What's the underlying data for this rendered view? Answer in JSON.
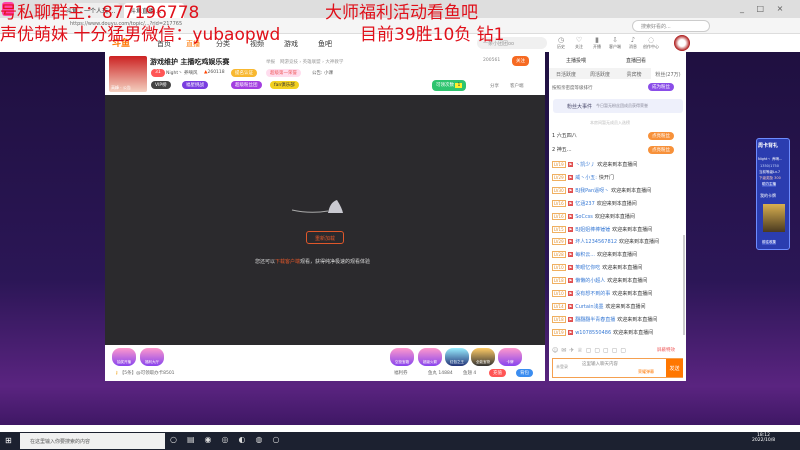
{
  "browser": {
    "tabs": [
      "斗鱼 - 一个人玩 ...",
      "斗鱼直播 ..."
    ],
    "url": "https://www.douyu.com/topic/...?rid=217765",
    "search_placeholder": "搜索好看的...",
    "window_controls": [
      "_",
      "□",
      "×"
    ]
  },
  "overlay": {
    "line1_left": "号私聊群主：877196778",
    "line1_right": "大师福利活动看鱼吧",
    "line2_left": "声优萌妹 十分猛男微信：yubaopwd",
    "line2_right": "目前39胜10负 钻1"
  },
  "nav": {
    "logo": "斗鱼",
    "items": [
      "首页",
      "直播",
      "分类",
      "视频",
      "游戏",
      "鱼吧"
    ],
    "search_value": "一条小团团oo",
    "icons": [
      {
        "name": "history",
        "label": "历史"
      },
      {
        "name": "follow",
        "label": "关注"
      },
      {
        "name": "broadcast",
        "label": "开播"
      },
      {
        "name": "client",
        "label": "客户端"
      },
      {
        "name": "message",
        "label": "消息"
      },
      {
        "name": "creator",
        "label": "创作中心"
      }
    ]
  },
  "room": {
    "title": "游戏维护 主播吃鸡娱乐赛",
    "report": "举报",
    "category": "网游竞技 › 英雄联盟 › 大神教学",
    "level": "31",
    "streamer": "Night丶 养嘀风",
    "hot": "260118",
    "tags": [
      "提名认证",
      "超级第一荣誉"
    ],
    "notice": "公告: 小课",
    "follow_count": "200561",
    "follow_label": "关注",
    "pic_label": "高峰 · 公告",
    "badges": [
      "VIP榜",
      "福星挑战",
      "超级粉丝团",
      "fan俱乐部"
    ],
    "claim_label": "可领次数",
    "claim_count": "1",
    "share": "分享",
    "client_label": "客户端"
  },
  "video": {
    "reload_label": "重新加载",
    "hint_before": "您还可以",
    "hint_link": "下载客户端",
    "hint_after": "观看，获得纯净极速的观看体验"
  },
  "bottom": {
    "left_gifts": [
      "抽奖开播",
      "福利大厅"
    ],
    "right_gifts": [
      "空投宝箱",
      "超级火箭",
      "红包之王",
      "全能宝物",
      "卡牌"
    ],
    "notice": "【5条】@可领取办卡8501",
    "welfare": "福利券",
    "fishball": "鱼丸 14884",
    "fishbar": "鱼翅 4",
    "charge": "充值",
    "bag": "背包"
  },
  "side": {
    "top_links": [
      "主播投喂",
      "直播回看"
    ],
    "tabs": [
      "日活跃度",
      "周活跃度",
      "贵宾榜",
      "粉丝(27万)"
    ],
    "rank_hint": "按照亲密度等级排行",
    "join_fans": "成为粉丝",
    "event_title": "粉丝大事件",
    "event_desc": "今日暂无粉丝团成员获得荣誉",
    "no_fans": "本房间暂无成员入选榜",
    "rank": [
      {
        "n": "1",
        "name": "六五四八",
        "action": "点亮粉丝"
      },
      {
        "n": "2",
        "name": "神五...",
        "action": "点亮粉丝"
      }
    ],
    "chat": [
      {
        "lv": "LV19",
        "user": "丶凯少丿",
        "msg": "欢迎来到本直播间"
      },
      {
        "lv": "LV29",
        "user": "威丶小五:",
        "msg": "快开门"
      },
      {
        "lv": "LV30",
        "user": "BJ我Pan逼呀丶",
        "msg": "欢迎来到本直播间"
      },
      {
        "lv": "LV16",
        "user": "忆涵237",
        "msg": "欢迎来到本直播间"
      },
      {
        "lv": "LV16",
        "user": "SoCcss",
        "msg": "欢迎来到本直播间"
      },
      {
        "lv": "LV15",
        "user": "BJ姐姐棒棒锤锤",
        "msg": "欢迎来到本直播间"
      },
      {
        "lv": "LV29",
        "user": "坏人1234567812",
        "msg": "欢迎来到本直播间"
      },
      {
        "lv": "LV28",
        "user": "每积云...",
        "msg": "欢迎来到本直播间"
      },
      {
        "lv": "LV10",
        "user": "笑眼忆你吃",
        "msg": "欢迎来到本直播间"
      },
      {
        "lv": "LV18",
        "user": "懒懒的小超人",
        "msg": "欢迎来到本直播间"
      },
      {
        "lv": "LV10",
        "user": "没有想不到的事",
        "msg": "欢迎来到本直播间"
      },
      {
        "lv": "LV14",
        "user": "Curtain浅墨",
        "msg": "欢迎来到本直播间"
      },
      {
        "lv": "LV18",
        "user": "翻翻翻半青春直播",
        "msg": "欢迎来到本直播间"
      },
      {
        "lv": "LV19",
        "user": "w1078550486",
        "msg": "欢迎来到本直播间"
      }
    ],
    "shield": "屏蔽特效",
    "input_placeholder": "这里输入聊天内容",
    "barrage": "荣耀弹幕",
    "send": "发送",
    "login": "未登录"
  },
  "widget": {
    "title": "周卡背礼",
    "user": "Night丶 养嘀...",
    "progress": "1350/1750",
    "level": "当前等级Lv.7",
    "next": "下级奖励 300",
    "btn1": "助力主播",
    "card_title": "我的卡牌",
    "btn2": "前往收集"
  },
  "taskbar": {
    "search": "在这里输入你要搜索的内容",
    "time": "18:12",
    "date": "2022/10/8"
  }
}
